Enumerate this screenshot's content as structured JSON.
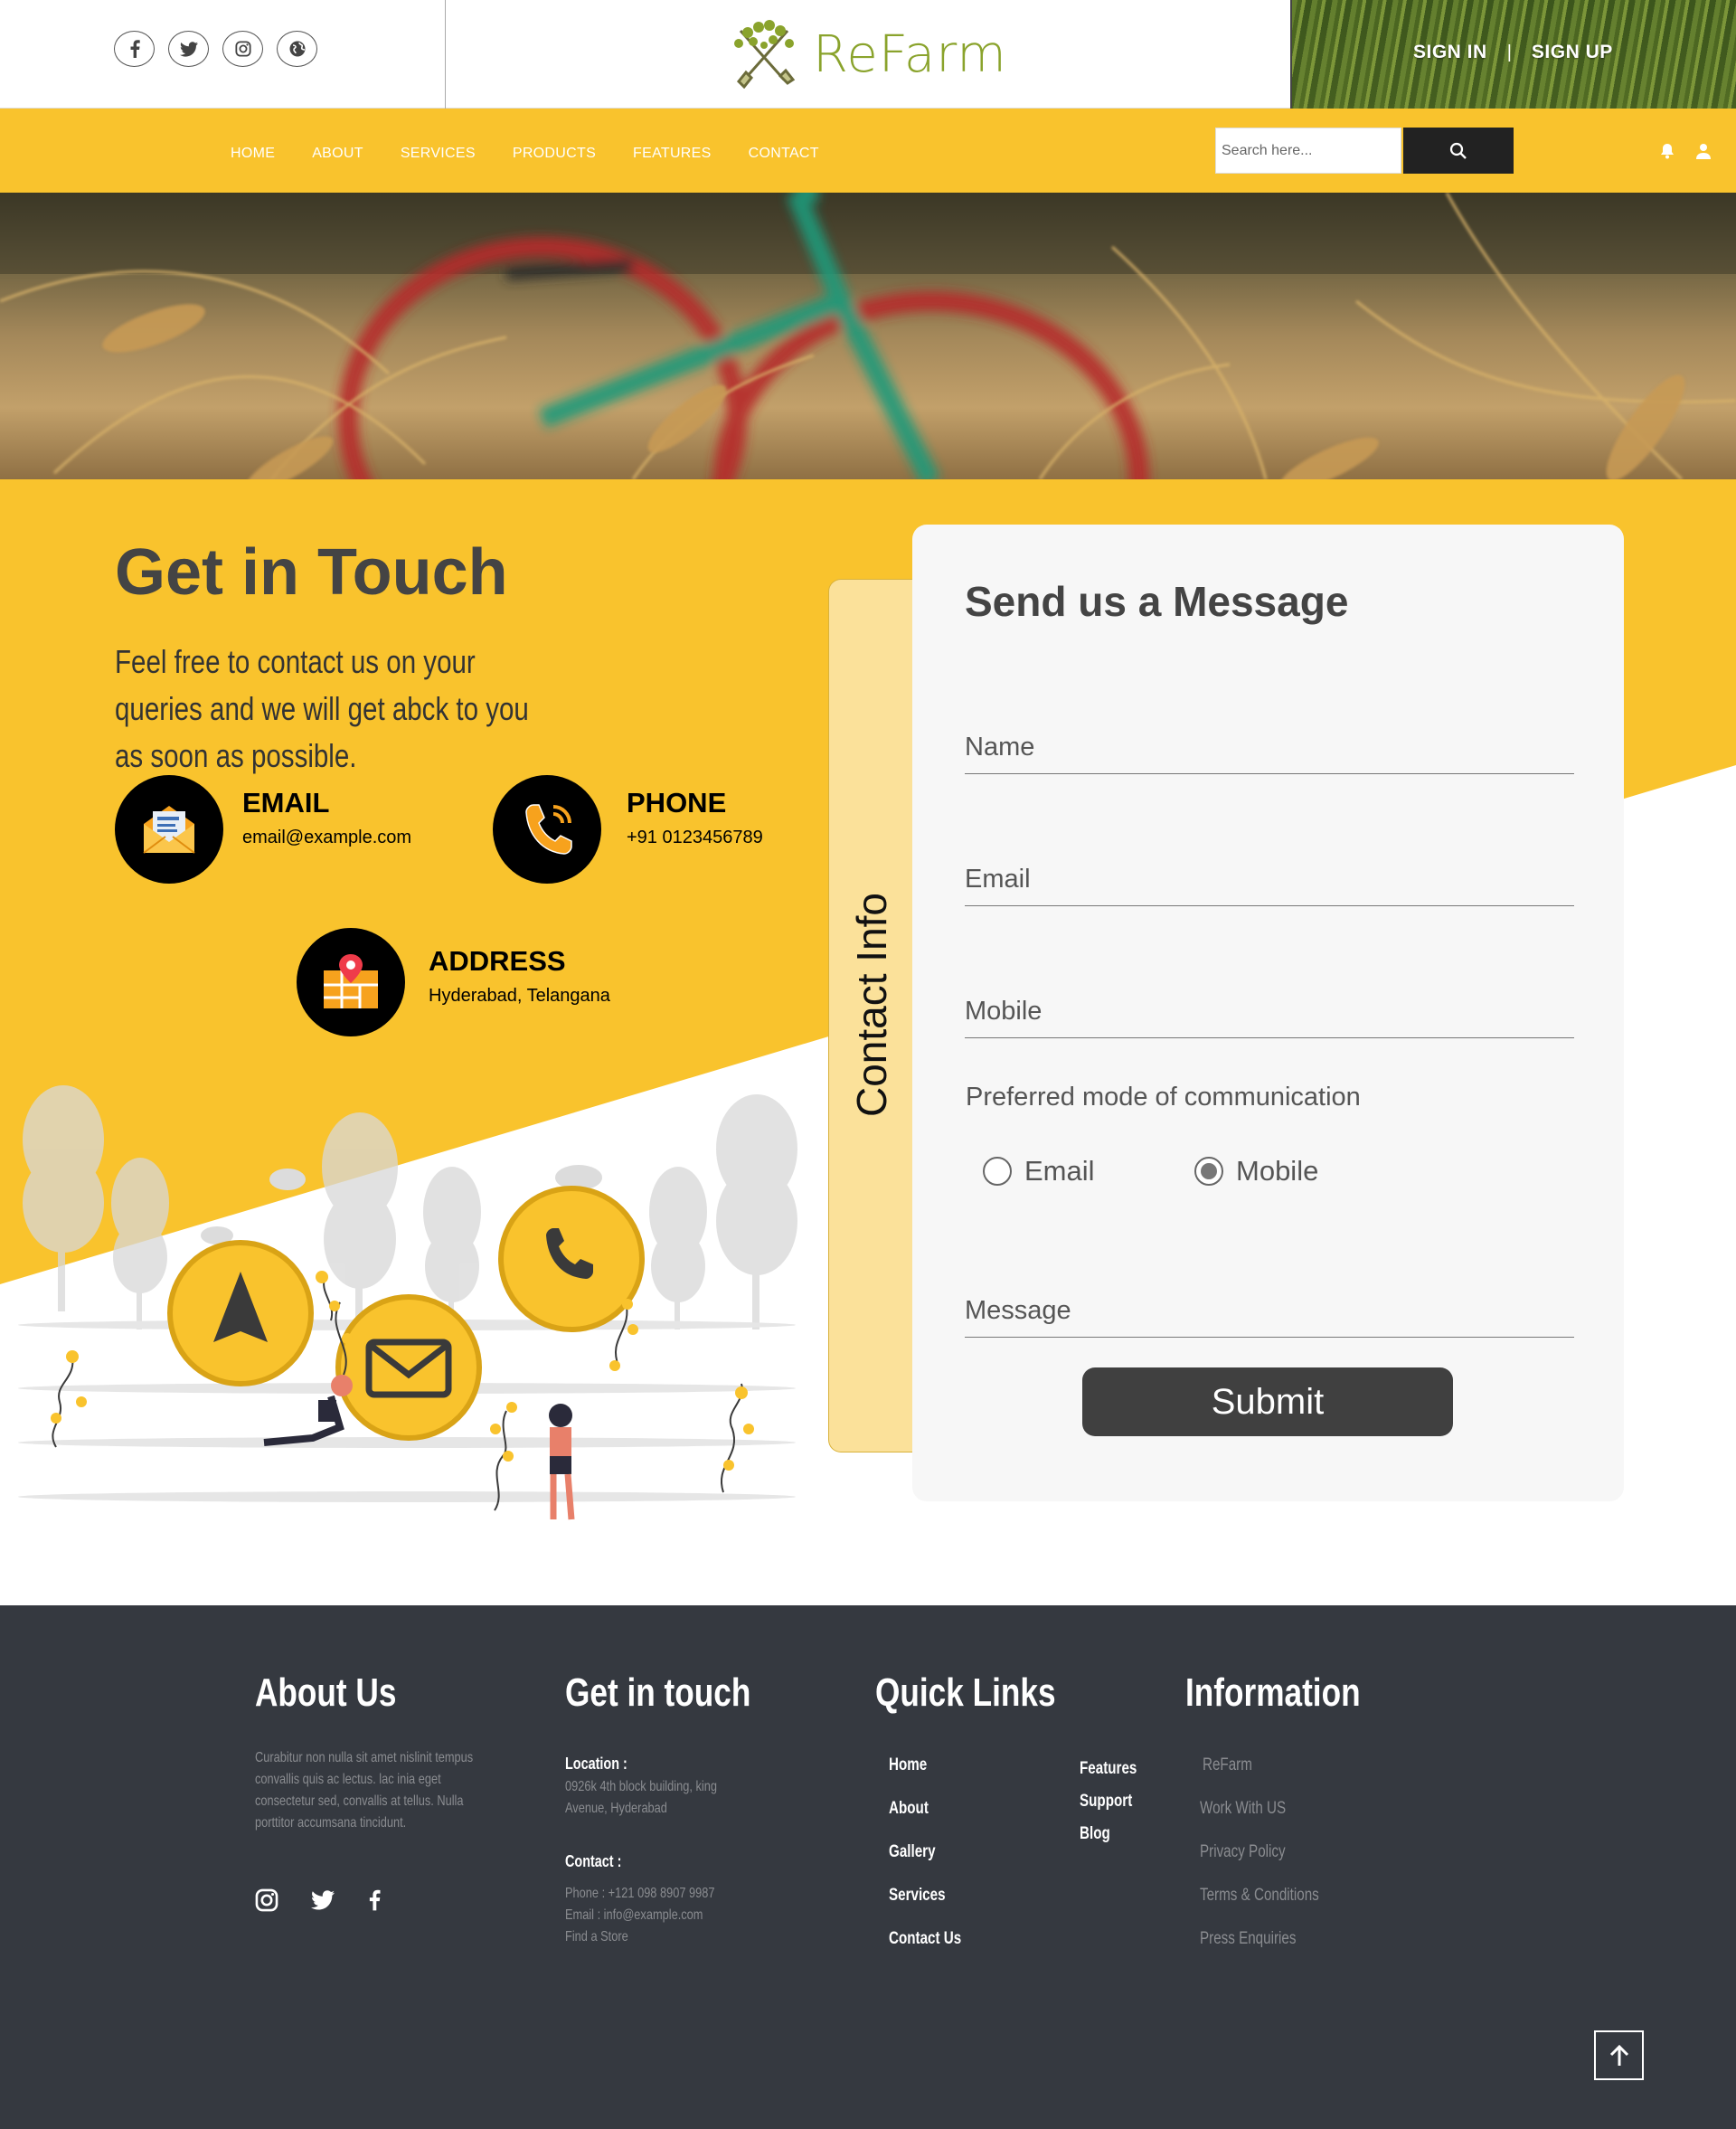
{
  "brand": {
    "name": "ReFarm",
    "accent": "#f9c32d",
    "logo_color": "#8aa32c"
  },
  "topbar": {
    "social_icons": [
      "facebook-icon",
      "twitter-icon",
      "instagram-icon",
      "globe-icon"
    ],
    "sign_in": "SIGN IN",
    "separator": "|",
    "sign_up": "SIGN UP"
  },
  "nav": {
    "items": [
      "HOME",
      "ABOUT",
      "SERVICES",
      "PRODUCTS",
      "FEATURES",
      "CONTACT"
    ],
    "search_placeholder": "Search here...",
    "icons": [
      "search-icon",
      "bell-icon",
      "user-icon"
    ]
  },
  "contact": {
    "title": "Get in Touch",
    "text": "Feel free to contact us on your queries and we will get abck to you as soon as possible.",
    "email_title": "EMAIL",
    "email_value": "email@example.com",
    "phone_title": "PHONE",
    "phone_value": "+91 0123456789",
    "address_title": "ADDRESS",
    "address_value": "Hyderabad, Telangana",
    "tab_label": "Contact Info"
  },
  "form": {
    "title": "Send us a Message",
    "name_placeholder": "Name",
    "email_placeholder": "Email",
    "mobile_placeholder": "Mobile",
    "pref_label": "Preferred mode of communication",
    "options": [
      "Email",
      "Mobile"
    ],
    "selected": "Mobile",
    "message_placeholder": "Message",
    "submit": "Submit"
  },
  "footer": {
    "about_title": "About Us",
    "about_text": "Curabitur non nulla sit amet nislinit tempus convallis quis ac lectus. lac inia eget consectetur sed, convallis at tellus. Nulla porttitor accumsana tincidunt.",
    "git_title": "Get in touch",
    "location_label": "Location :",
    "location_value": "0926k 4th block building, king Avenue, Hyderabad",
    "contact_label": "Contact :",
    "phone": "Phone : +121 098 8907 9987",
    "email": "Email : info@example.com",
    "store": "Find a Store",
    "links_title": "Quick Links",
    "links_col1": [
      "Home",
      "About",
      "Gallery",
      "Services",
      "Contact Us"
    ],
    "links_col2": [
      "Features",
      "Support",
      "Blog"
    ],
    "info_title": "Information",
    "info_links": [
      "ReFarm",
      "Work With US",
      "Privacy Policy",
      "Terms & Conditions",
      "Press Enquiries"
    ]
  }
}
